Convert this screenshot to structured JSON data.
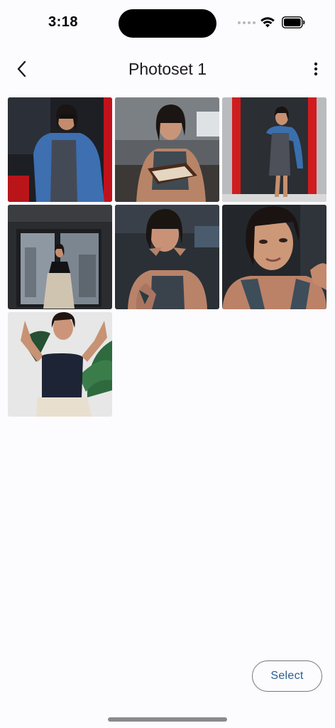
{
  "status_bar": {
    "time": "3:18"
  },
  "header": {
    "title": "Photoset 1",
    "back_icon": "chevron-left-icon",
    "menu_icon": "more-vertical-icon"
  },
  "photos": [
    {
      "subject": "denim-jacket-storefront"
    },
    {
      "subject": "reading-book"
    },
    {
      "subject": "doorway-red-frame"
    },
    {
      "subject": "window-building"
    },
    {
      "subject": "chin-on-hands"
    },
    {
      "subject": "portrait-closeup"
    },
    {
      "subject": "arms-raised-plant"
    }
  ],
  "footer": {
    "select_label": "Select"
  },
  "colors": {
    "accent": "#2a5d8f",
    "background": "#fcfbfd",
    "outline": "#79747e"
  }
}
